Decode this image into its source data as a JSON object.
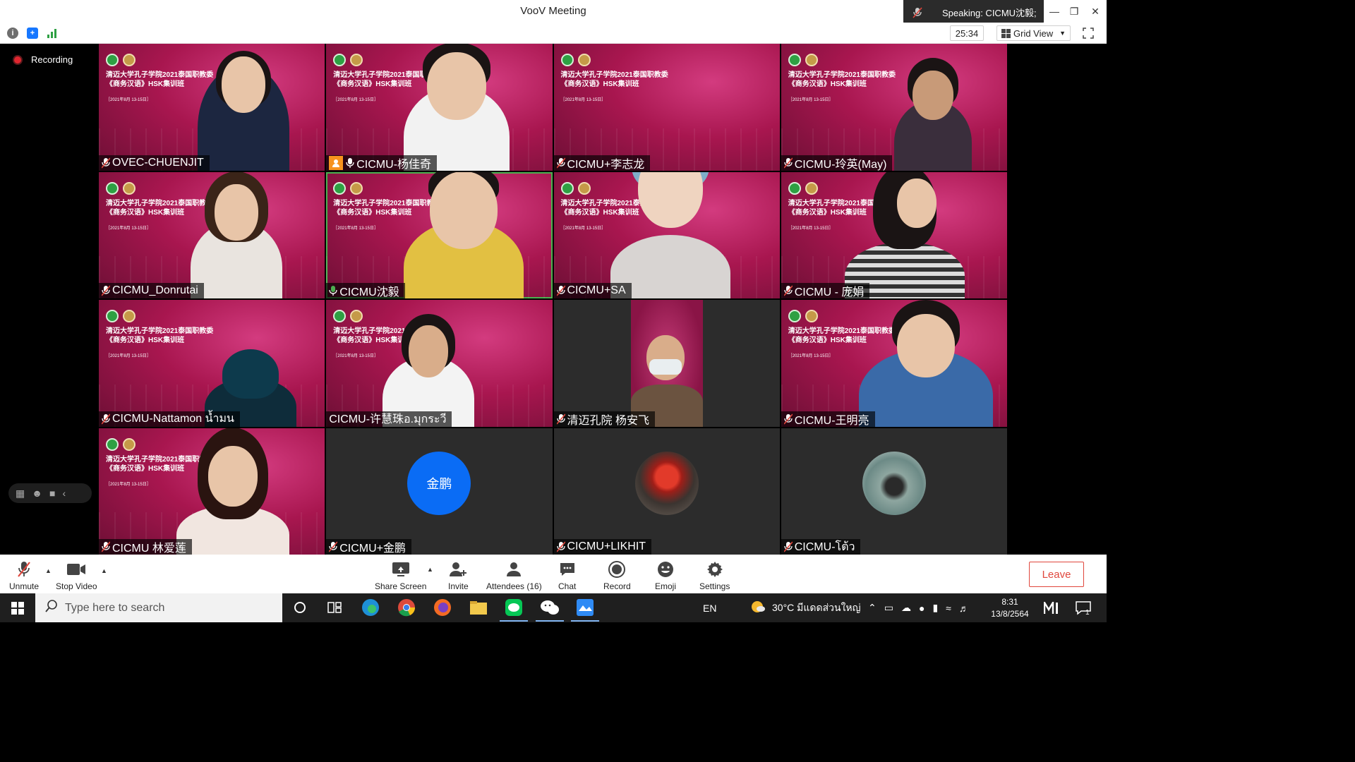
{
  "window": {
    "title": "VooV Meeting"
  },
  "speaking": {
    "label": "Speaking: CICMU沈毅;"
  },
  "meeting": {
    "timer": "25:34",
    "view_mode": "Grid View",
    "recording_label": "Recording"
  },
  "banner": {
    "line1": "清迈大学孔子学院2021泰国职教委",
    "line2": "《商务汉语》HSK集训班",
    "date": "［2021年8月 13-15日］"
  },
  "participants": [
    {
      "name": "OVEC-CHUENJIT"
    },
    {
      "name": "CICMU-杨佳奇"
    },
    {
      "name": "CICMU+李志龙"
    },
    {
      "name": "CICMU-玲英(May)"
    },
    {
      "name": "CICMU_Donrutai"
    },
    {
      "name": "CICMU沈毅"
    },
    {
      "name": "CICMU+SA"
    },
    {
      "name": "CICMU - 庞娟"
    },
    {
      "name": "CICMU-Nattamon น้ำมน"
    },
    {
      "name": "CICMU-许慧珠อ.มุกระวี"
    },
    {
      "name": "清迈孔院 杨安飞"
    },
    {
      "name": "CICMU-王明亮"
    },
    {
      "name": "CICMU 林爱莲"
    },
    {
      "name": "CICMU+金鹏",
      "avatar_text": "金鹏"
    },
    {
      "name": "CICMU+LIKHIT"
    },
    {
      "name": "CICMU-โต้ว"
    }
  ],
  "controls": {
    "unmute": "Unmute",
    "stop_video": "Stop Video",
    "share_screen": "Share Screen",
    "invite": "Invite",
    "attendees": "Attendees (16)",
    "chat": "Chat",
    "record": "Record",
    "emoji": "Emoji",
    "settings": "Settings",
    "leave": "Leave"
  },
  "taskbar": {
    "search_placeholder": "Type here to search",
    "language": "EN",
    "weather": "30°C มีแดดส่วนใหญ่",
    "time": "8:31",
    "date": "13/8/2564",
    "notification_count": "1"
  },
  "colors": {
    "accent_blue": "#0a6cf5",
    "leave_red": "#e0463c",
    "banner_magenta": "#a8164f",
    "active_speaker": "#4caf50"
  }
}
